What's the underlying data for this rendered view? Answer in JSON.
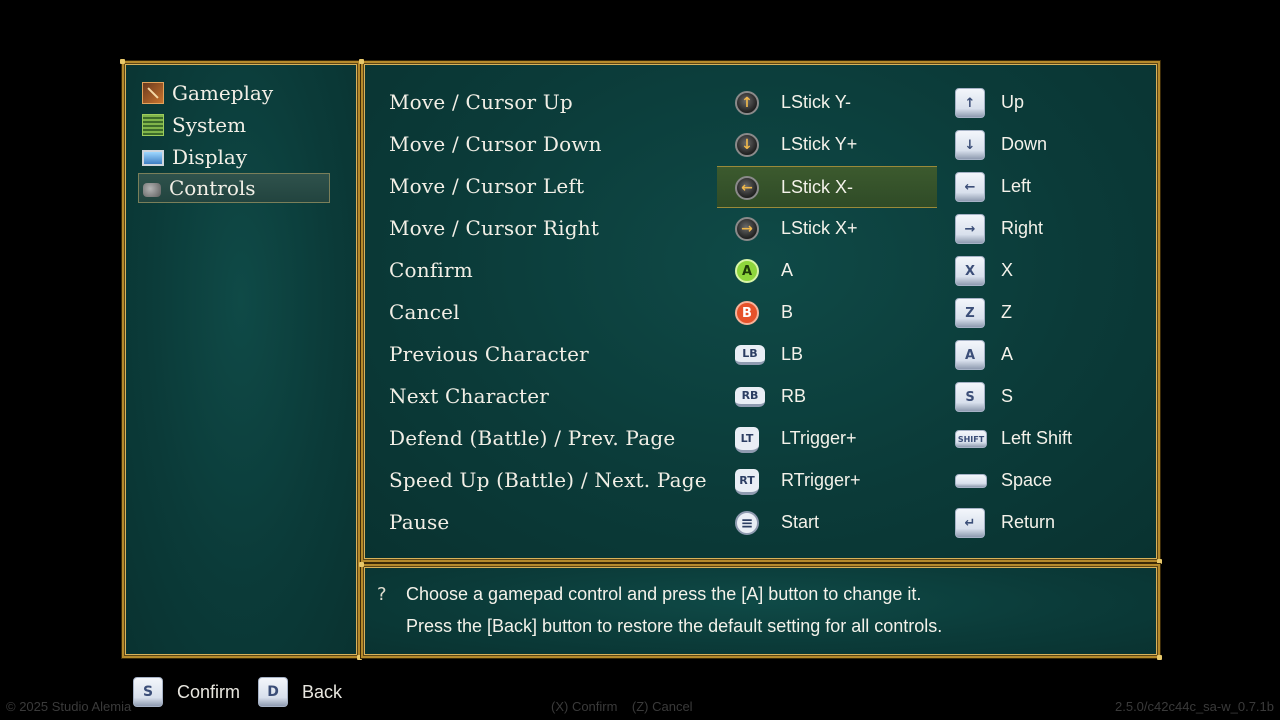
{
  "sidebar": {
    "items": [
      {
        "label": "Gameplay",
        "icon": "gameplay-icon"
      },
      {
        "label": "System",
        "icon": "system-icon"
      },
      {
        "label": "Display",
        "icon": "display-icon"
      },
      {
        "label": "Controls",
        "icon": "controls-icon",
        "selected": true
      }
    ]
  },
  "controls": [
    {
      "action": "Move / Cursor Up",
      "pad": {
        "glyph": "↑",
        "icon": "left-stick-up-icon",
        "label": "LStick Y-"
      },
      "key": {
        "glyph": "↑",
        "icon": "up-key-icon",
        "label": "Up"
      }
    },
    {
      "action": "Move / Cursor Down",
      "pad": {
        "glyph": "↓",
        "icon": "left-stick-down-icon",
        "label": "LStick Y+"
      },
      "key": {
        "glyph": "↓",
        "icon": "down-key-icon",
        "label": "Down"
      }
    },
    {
      "action": "Move / Cursor Left",
      "pad": {
        "glyph": "←",
        "icon": "left-stick-left-icon",
        "label": "LStick X-"
      },
      "key": {
        "glyph": "←",
        "icon": "left-key-icon",
        "label": "Left"
      }
    },
    {
      "action": "Move / Cursor Right",
      "pad": {
        "glyph": "→",
        "icon": "left-stick-right-icon",
        "label": "LStick X+"
      },
      "key": {
        "glyph": "→",
        "icon": "right-key-icon",
        "label": "Right"
      }
    },
    {
      "action": "Confirm",
      "pad": {
        "glyph": "A",
        "icon": "a-button-icon",
        "label": "A"
      },
      "key": {
        "glyph": "X",
        "icon": "x-key-icon",
        "label": "X"
      }
    },
    {
      "action": "Cancel",
      "pad": {
        "glyph": "B",
        "icon": "b-button-icon",
        "label": "B"
      },
      "key": {
        "glyph": "Z",
        "icon": "z-key-icon",
        "label": "Z"
      }
    },
    {
      "action": "Previous Character",
      "pad": {
        "glyph": "LB",
        "icon": "lb-button-icon",
        "label": "LB"
      },
      "key": {
        "glyph": "A",
        "icon": "a-key-icon",
        "label": "A"
      }
    },
    {
      "action": "Next Character",
      "pad": {
        "glyph": "RB",
        "icon": "rb-button-icon",
        "label": "RB"
      },
      "key": {
        "glyph": "S",
        "icon": "s-key-icon",
        "label": "S"
      }
    },
    {
      "action": "Defend (Battle) / Prev. Page",
      "pad": {
        "glyph": "LT",
        "icon": "lt-trigger-icon",
        "label": "LTrigger+"
      },
      "key": {
        "glyph": "SHIFT",
        "icon": "shift-key-icon",
        "label": "Left Shift"
      }
    },
    {
      "action": "Speed Up (Battle) / Next. Page",
      "pad": {
        "glyph": "RT",
        "icon": "rt-trigger-icon",
        "label": "RTrigger+"
      },
      "key": {
        "glyph": "",
        "icon": "space-key-icon",
        "label": "Space"
      }
    },
    {
      "action": "Pause",
      "pad": {
        "glyph": "≡",
        "icon": "start-button-icon",
        "label": "Start"
      },
      "key": {
        "glyph": "↵",
        "icon": "return-key-icon",
        "label": "Return"
      }
    }
  ],
  "help": {
    "icon": "question-icon",
    "glyph": "?",
    "line1": "Choose a gamepad control and press the [A] button to change it.",
    "line2": "Press the [Back] button to restore the default setting for all controls."
  },
  "footer": {
    "confirm_key": "S",
    "confirm_label": "Confirm",
    "back_key": "D",
    "back_label": "Back",
    "copyright": "© 2025 Studio Alemia",
    "hints": "(X) Confirm    (Z) Cancel",
    "version": "2.5.0/c42c44c_sa-w_0.7.1b"
  },
  "colors": {
    "panel_bg": "#0b3b39",
    "border_gold": "#b58a2c",
    "selected_bg": "#3c5a2e"
  }
}
